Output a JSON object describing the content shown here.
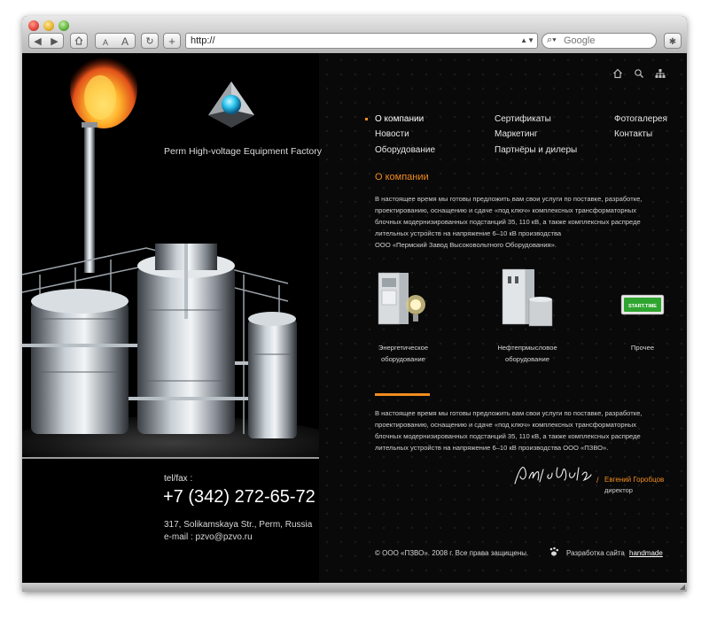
{
  "browser": {
    "url": "http://",
    "search_placeholder": "Google",
    "text_smaller": "A",
    "text_larger": "A",
    "add_label": "+"
  },
  "company": {
    "name": "Perm High-voltage Equipment Factory"
  },
  "nav": {
    "col1": [
      "О компании",
      "Новости",
      "Оборудование"
    ],
    "col2": [
      "Сертификаты",
      "Маркетинг",
      "Партнёры и дилеры"
    ],
    "col3": [
      "Фотогалерея",
      "Контакты"
    ]
  },
  "section": {
    "title": "О компании",
    "paragraph1": [
      "В настоящее время мы готовы предложить вам свои услуги по поставке, разработке,",
      "проектированию, оснащению и сдаче «под ключ» комплексных трансформаторных",
      "блочных модернизированных подстанций 35, 110 кВ, а также комплексных распреде",
      "лительных устройств на напряжение 6–10 кВ производства",
      "ООО «Пермский Завод Высоковольтного Оборудования»."
    ],
    "paragraph2": [
      "В настоящее время мы готовы предложить вам свои услуги по поставке, разработке,",
      "проектированию, оснащению и сдаче «под ключ» комплексных трансформаторных",
      "блочных модернизированных подстанций 35, 110 кВ, а также комплексных распреде",
      "лительных устройств на напряжение 6–10 кВ производства ООО «ПЗВО»."
    ]
  },
  "products": [
    {
      "line1": "Энергетическое",
      "line2": "оборудование"
    },
    {
      "line1": "Нефтепрмысловое",
      "line2": "оборудование"
    },
    {
      "line1": "Прочее",
      "line2": ""
    }
  ],
  "product_badge": "START.TIME",
  "signature": {
    "name": "Евгений Горобцов",
    "title": "директор"
  },
  "contact": {
    "label": "tel/fax :",
    "phone": "+7 (342) 272-65-72",
    "address": "317, Solikamskaya Str., Perm, Russia",
    "email": "e-mail : pzvo@pzvo.ru"
  },
  "footer": {
    "copyright": "©  ООО «ПЗВО». 2008 г. Все права защищены.",
    "dev_label": "Разработка сайта",
    "dev_link": "handmade"
  },
  "colors": {
    "accent": "#f28d1e",
    "background": "#090909"
  }
}
